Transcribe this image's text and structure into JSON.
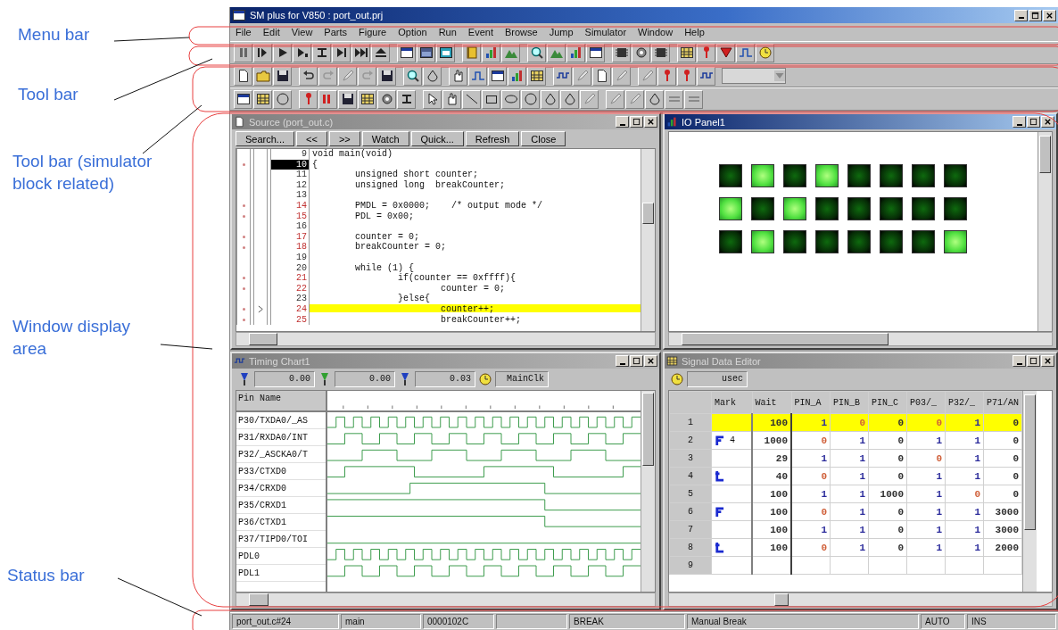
{
  "annotations": [
    {
      "label": "Menu bar"
    },
    {
      "label": "Tool bar"
    },
    {
      "label": "Tool bar (simulator block related)"
    },
    {
      "label": "Window display area"
    },
    {
      "label": "Status bar"
    }
  ],
  "window": {
    "title": "SM plus for V850 : port_out.prj"
  },
  "menu": [
    "File",
    "Edit",
    "View",
    "Parts",
    "Figure",
    "Option",
    "Run",
    "Event",
    "Browse",
    "Jump",
    "Simulator",
    "Window",
    "Help"
  ],
  "source_window": {
    "title": "Source (port_out.c)",
    "active": false,
    "buttons": [
      "Search...",
      "<<",
      ">>",
      "Watch",
      "Quick...",
      "Refresh",
      "Close"
    ],
    "lines": [
      {
        "number": "9",
        "code": "void main(void)",
        "executable": false,
        "selected": false,
        "current": false
      },
      {
        "number": "10",
        "code": "{",
        "executable": true,
        "selected": true,
        "current": false
      },
      {
        "number": "11",
        "code": "        unsigned short counter;",
        "executable": false,
        "selected": false,
        "current": false
      },
      {
        "number": "12",
        "code": "        unsigned long  breakCounter;",
        "executable": false,
        "selected": false,
        "current": false
      },
      {
        "number": "13",
        "executable": false,
        "selected": false,
        "current": false
      },
      {
        "number": "14",
        "code": "        PMDL = 0x0000;    /* output mode */",
        "executable": true,
        "selected": false,
        "current": false
      },
      {
        "number": "15",
        "code": "        PDL = 0x00;",
        "executable": true,
        "selected": false,
        "current": false
      },
      {
        "number": "16",
        "executable": false,
        "selected": false,
        "current": false
      },
      {
        "number": "17",
        "code": "        counter = 0;",
        "executable": true,
        "selected": false,
        "current": false
      },
      {
        "number": "18",
        "code": "        breakCounter = 0;",
        "executable": true,
        "selected": false,
        "current": false
      },
      {
        "number": "19",
        "executable": false,
        "selected": false,
        "current": false
      },
      {
        "number": "20",
        "code": "        while (1) {",
        "executable": false,
        "selected": false,
        "current": false
      },
      {
        "number": "21",
        "code": "                if(counter == 0xffff){",
        "executable": true,
        "selected": false,
        "current": false
      },
      {
        "number": "22",
        "code": "                        counter = 0;",
        "executable": true,
        "selected": false,
        "current": false
      },
      {
        "number": "23",
        "code": "                }else{",
        "executable": false,
        "selected": false,
        "current": false
      },
      {
        "number": "24",
        "code": "                        counter++;",
        "executable": true,
        "selected": false,
        "current": true
      },
      {
        "number": "25",
        "code": "                        breakCounter++;",
        "executable": true,
        "selected": false,
        "current": false
      }
    ]
  },
  "io_panel": {
    "title": "IO Panel1",
    "active": true,
    "rows": [
      {
        "leds": [
          {
            "on": false
          },
          {
            "on": true
          },
          {
            "on": false
          },
          {
            "on": true
          },
          {
            "on": false
          },
          {
            "on": false
          },
          {
            "on": false
          },
          {
            "on": false
          }
        ]
      },
      {
        "leds": [
          {
            "on": true
          },
          {
            "on": false
          },
          {
            "on": true
          },
          {
            "on": false
          },
          {
            "on": false
          },
          {
            "on": false
          },
          {
            "on": false
          },
          {
            "on": false
          }
        ]
      },
      {
        "leds": [
          {
            "on": false
          },
          {
            "on": true
          },
          {
            "on": false
          },
          {
            "on": false
          },
          {
            "on": false
          },
          {
            "on": false
          },
          {
            "on": false
          },
          {
            "on": true
          }
        ]
      }
    ]
  },
  "timing_chart": {
    "title": "Timing Chart1",
    "active": false,
    "fields": [
      "0.00",
      "0.00",
      "0.03",
      "MainClk"
    ],
    "pin_header": "Pin Name",
    "pins": [
      "P30/TXDA0/_AS",
      "P31/RXDA0/INT",
      "P32/_ASCKA0/T",
      "P33/CTXD0",
      "P34/CRXD0",
      "P35/CRXD1",
      "P36/CTXD1",
      "P37/TIPD0/TOI",
      "PDL0",
      "PDL1"
    ]
  },
  "signal_editor": {
    "title": "Signal Data Editor",
    "active": false,
    "unit": "usec",
    "columns": [
      "Mark",
      "Wait",
      "PIN_A",
      "PIN_B",
      "PIN_C",
      "P03/_",
      "P32/_",
      "P71/AN"
    ],
    "rows": [
      {
        "number": "1",
        "selected": true,
        "cells": [
          {
            "text": "100",
            "color": "#303030"
          },
          {
            "text": "1",
            "color": "#2b2b9b"
          },
          {
            "text": "0",
            "color": "#d0603a"
          },
          {
            "text": "0",
            "color": "#303030"
          },
          {
            "text": "0",
            "color": "#d0603a"
          },
          {
            "text": "1",
            "color": "#2b2b9b"
          },
          {
            "text": "0",
            "color": "#303030"
          }
        ]
      },
      {
        "number": "2",
        "selected": false,
        "mark": {
          "kind": "loop-start",
          "count": "4"
        },
        "cells": [
          {
            "text": "1000",
            "color": "#303030"
          },
          {
            "text": "0",
            "color": "#d0603a"
          },
          {
            "text": "1",
            "color": "#2b2b9b"
          },
          {
            "text": "0",
            "color": "#303030"
          },
          {
            "text": "1",
            "color": "#2b2b9b"
          },
          {
            "text": "1",
            "color": "#2b2b9b"
          },
          {
            "text": "0",
            "color": "#303030"
          }
        ]
      },
      {
        "number": "3",
        "selected": false,
        "cells": [
          {
            "text": "29",
            "color": "#303030"
          },
          {
            "text": "1",
            "color": "#2b2b9b"
          },
          {
            "text": "1",
            "color": "#2b2b9b"
          },
          {
            "text": "0",
            "color": "#303030"
          },
          {
            "text": "0",
            "color": "#d0603a"
          },
          {
            "text": "1",
            "color": "#2b2b9b"
          },
          {
            "text": "0",
            "color": "#303030"
          }
        ]
      },
      {
        "number": "4",
        "selected": false,
        "mark": {
          "kind": "loop-end"
        },
        "cells": [
          {
            "text": "40",
            "color": "#303030"
          },
          {
            "text": "0",
            "color": "#d0603a"
          },
          {
            "text": "1",
            "color": "#2b2b9b"
          },
          {
            "text": "0",
            "color": "#303030"
          },
          {
            "text": "1",
            "color": "#2b2b9b"
          },
          {
            "text": "1",
            "color": "#2b2b9b"
          },
          {
            "text": "0",
            "color": "#303030"
          }
        ]
      },
      {
        "number": "5",
        "selected": false,
        "cells": [
          {
            "text": "100",
            "color": "#303030"
          },
          {
            "text": "1",
            "color": "#2b2b9b"
          },
          {
            "text": "1",
            "color": "#2b2b9b"
          },
          {
            "text": "1000",
            "color": "#303030"
          },
          {
            "text": "1",
            "color": "#2b2b9b"
          },
          {
            "text": "0",
            "color": "#d0603a"
          },
          {
            "text": "0",
            "color": "#303030"
          }
        ]
      },
      {
        "number": "6",
        "selected": false,
        "mark": {
          "kind": "loop-start"
        },
        "cells": [
          {
            "text": "100",
            "color": "#303030"
          },
          {
            "text": "0",
            "color": "#d0603a"
          },
          {
            "text": "1",
            "color": "#2b2b9b"
          },
          {
            "text": "0",
            "color": "#303030"
          },
          {
            "text": "1",
            "color": "#2b2b9b"
          },
          {
            "text": "1",
            "color": "#2b2b9b"
          },
          {
            "text": "3000",
            "color": "#303030"
          }
        ]
      },
      {
        "number": "7",
        "selected": false,
        "cells": [
          {
            "text": "100",
            "color": "#303030"
          },
          {
            "text": "1",
            "color": "#2b2b9b"
          },
          {
            "text": "1",
            "color": "#2b2b9b"
          },
          {
            "text": "0",
            "color": "#303030"
          },
          {
            "text": "1",
            "color": "#2b2b9b"
          },
          {
            "text": "1",
            "color": "#2b2b9b"
          },
          {
            "text": "3000",
            "color": "#303030"
          }
        ]
      },
      {
        "number": "8",
        "selected": false,
        "mark": {
          "kind": "loop-end"
        },
        "cells": [
          {
            "text": "100",
            "color": "#303030"
          },
          {
            "text": "0",
            "color": "#d0603a"
          },
          {
            "text": "1",
            "color": "#2b2b9b"
          },
          {
            "text": "0",
            "color": "#303030"
          },
          {
            "text": "1",
            "color": "#2b2b9b"
          },
          {
            "text": "1",
            "color": "#2b2b9b"
          },
          {
            "text": "2000",
            "color": "#303030"
          }
        ]
      },
      {
        "number": "9",
        "selected": false
      }
    ]
  },
  "status_bar": [
    "port_out.c#24",
    "main",
    "0000102C",
    "BREAK",
    "Manual Break",
    "AUTO",
    "INS"
  ]
}
